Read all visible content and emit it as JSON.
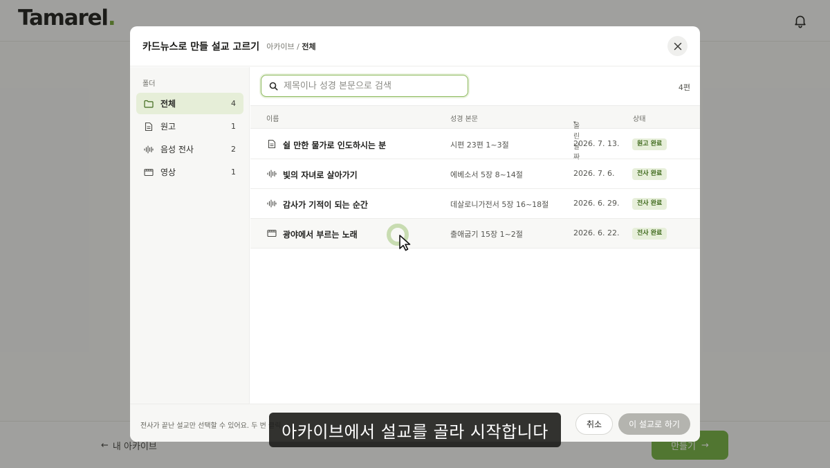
{
  "app": {
    "logo": "Tamarel",
    "logo_dot": ".",
    "back_label": "내 아카이브",
    "make_label": "만들기"
  },
  "modal": {
    "title": "카드뉴스로 만들 설교 고르기",
    "breadcrumb_root": "아카이브 / ",
    "breadcrumb_current": "전체"
  },
  "sidebar": {
    "title": "폴더",
    "items": [
      {
        "label": "전체",
        "count": "4",
        "icon": "folder-icon"
      },
      {
        "label": "원고",
        "count": "1",
        "icon": "document-icon"
      },
      {
        "label": "음성 전사",
        "count": "2",
        "icon": "audio-waveform-icon"
      },
      {
        "label": "영상",
        "count": "1",
        "icon": "video-icon"
      }
    ]
  },
  "search": {
    "placeholder": "제목이나 성경 본문으로 검색",
    "value": ""
  },
  "total_count": "4편",
  "table": {
    "headers": {
      "name": "이름",
      "passage": "성경 본문",
      "date": "올린 날짜",
      "status": "상태"
    },
    "sort_indicator": "▾",
    "rows": [
      {
        "icon": "document-icon",
        "title": "쉴 만한 물가로 인도하시는 분",
        "passage": "시편 23편 1~3절",
        "date": "2026. 7. 13.",
        "status": "원고 완료"
      },
      {
        "icon": "audio-waveform-icon",
        "title": "빛의 자녀로 살아가기",
        "passage": "에베소서 5장 8~14절",
        "date": "2026. 7. 6.",
        "status": "전사 완료"
      },
      {
        "icon": "audio-waveform-icon",
        "title": "감사가 기적이 되는 순간",
        "passage": "데살로니가전서 5장 16~18절",
        "date": "2026. 6. 29.",
        "status": "전사 완료"
      },
      {
        "icon": "video-icon",
        "title": "광야에서 부르는 노래",
        "passage": "출애굽기 15장 1~2절",
        "date": "2026. 6. 22.",
        "status": "전사 완료"
      }
    ]
  },
  "footer": {
    "note": "전사가 끝난 설교만 선택할 수 있어요. 두 번 클릭",
    "cancel": "취소",
    "confirm": "이 설교로 하기"
  },
  "caption": "아카이브에서 설교를 골라 시작합니다",
  "colors": {
    "accent": "#6fa12f",
    "badge_bg": "#e7efda",
    "badge_text": "#3f6a1c"
  }
}
